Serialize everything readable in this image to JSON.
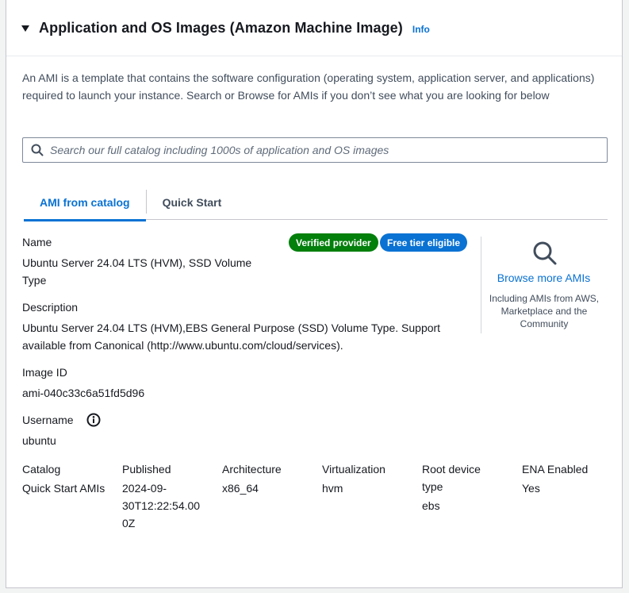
{
  "header": {
    "title": "Application and OS Images (Amazon Machine Image)",
    "info": "Info"
  },
  "description": "An AMI is a template that contains the software configuration (operating system, application server, and applications) required to launch your instance. Search or Browse for AMIs if you don’t see what you are looking for below",
  "search": {
    "placeholder": "Search our full catalog including 1000s of application and OS images",
    "value": ""
  },
  "tabs": [
    {
      "label": "AMI from catalog",
      "active": true
    },
    {
      "label": "Quick Start",
      "active": false
    }
  ],
  "ami": {
    "name_label": "Name",
    "name_line1": "Ubuntu Server 24.04 LTS (HVM), SSD Volume",
    "name_line2": "Type",
    "badge_verified": "Verified provider",
    "badge_free_tier": "Free tier eligible",
    "description_label": "Description",
    "description_line1": "Ubuntu Server 24.04 LTS (HVM),EBS General Purpose (SSD) Volume Type. Support",
    "description_line2": "available from Canonical (http://www.ubuntu.com/cloud/services).",
    "image_id_label": "Image ID",
    "image_id": "ami-040c33c6a51fd5d96",
    "username_label": "Username",
    "username": "ubuntu"
  },
  "browse": {
    "link": "Browse more AMIs",
    "note": "Including AMIs from AWS, Marketplace and the Community"
  },
  "details": {
    "catalog": {
      "label": "Catalog",
      "value": "Quick Start AMIs"
    },
    "published": {
      "label": "Published",
      "value_lines": [
        "2024-09-",
        "30T12:22:54.00",
        "0Z"
      ]
    },
    "architecture": {
      "label": "Architecture",
      "value": "x86_64"
    },
    "virtualization": {
      "label": "Virtualization",
      "value": "hvm"
    },
    "root_device": {
      "label_lines": [
        "Root device",
        "type"
      ],
      "value": "ebs"
    },
    "ena": {
      "label": "ENA Enabled",
      "value": "Yes"
    }
  },
  "colors": {
    "link": "#0972d3",
    "badge_green": "#037f0c",
    "badge_blue": "#0972d3"
  },
  "icons": [
    "caret-down-icon",
    "search-icon",
    "magnifier-icon",
    "info-circle-icon"
  ]
}
